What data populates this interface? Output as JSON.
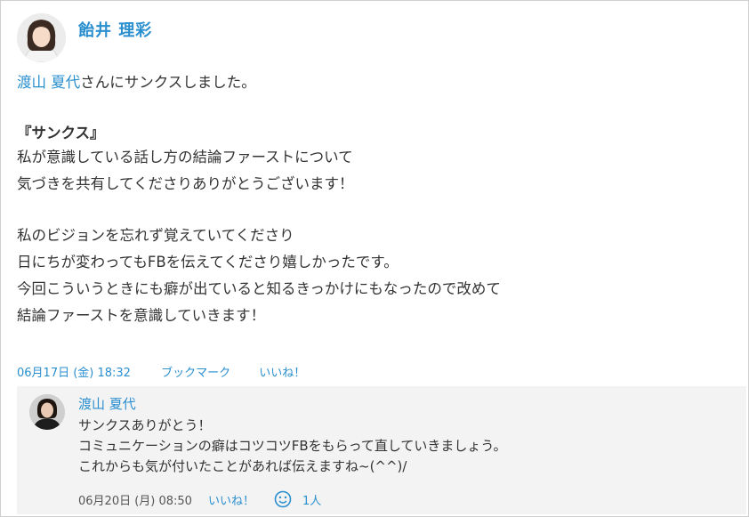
{
  "post": {
    "author": "飴井 理彩",
    "line1_link": "渡山 夏代",
    "line1_text": "さんにサンクスしました。",
    "thanks_title": "『サンクス』",
    "body1": [
      "私が意識している話し方の結論ファーストについて",
      "気づきを共有してくださりありがとうございます！"
    ],
    "body2": [
      "私のビジョンを忘れず覚えていてくださり",
      "日にちが変わってもFBを伝えてくださり嬉しかったです。",
      "今回こういうときにも癖が出ていると知るきっかけにもなったので改めて",
      "結論ファーストを意識していきます！"
    ],
    "date": "06月17日 (金) 18:32",
    "bookmark": "ブックマーク",
    "like": "いいね！"
  },
  "reply": {
    "author": "渡山 夏代",
    "lines": [
      "サンクスありがとう！",
      "コミュニケーションの癖はコツコツFBをもらって直していきましょう。",
      "これからも気が付いたことがあれば伝えますね~(^^)/"
    ],
    "date": "06月20日 (月) 08:50",
    "like": "いいね！",
    "reaction_count": "1人"
  },
  "colors": {
    "link": "#2a8fcf",
    "reply_bg": "#f3f3f3"
  }
}
